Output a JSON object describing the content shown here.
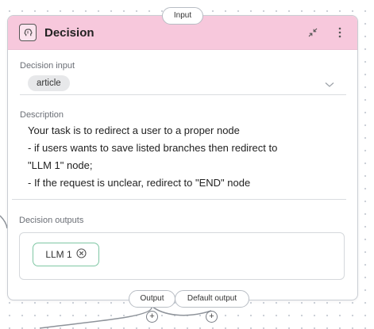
{
  "node": {
    "input_handle": "Input",
    "title": "Decision",
    "decision_input_label": "Decision input",
    "decision_input_value": "article",
    "description_label": "Description",
    "description_lines": [
      "Your task is to redirect a user to a proper node",
      "- if users wants to save listed branches then redirect to",
      "\"LLM 1\" node;",
      "- If the request is unclear, redirect to \"END\" node"
    ],
    "outputs_label": "Decision outputs",
    "outputs": [
      {
        "label": "LLM 1"
      }
    ],
    "output_handle": "Output",
    "default_output_handle": "Default output"
  },
  "colors": {
    "header_bg": "#f7c8dc",
    "output_chip_border": "#7fc7a4"
  },
  "icons": {
    "node_icon": "brain-icon",
    "collapse": "collapse-arrows-icon",
    "menu": "vertical-dots-icon",
    "dropdown": "chevron-down-icon",
    "remove": "circle-x-icon",
    "add": "plus-icon"
  }
}
